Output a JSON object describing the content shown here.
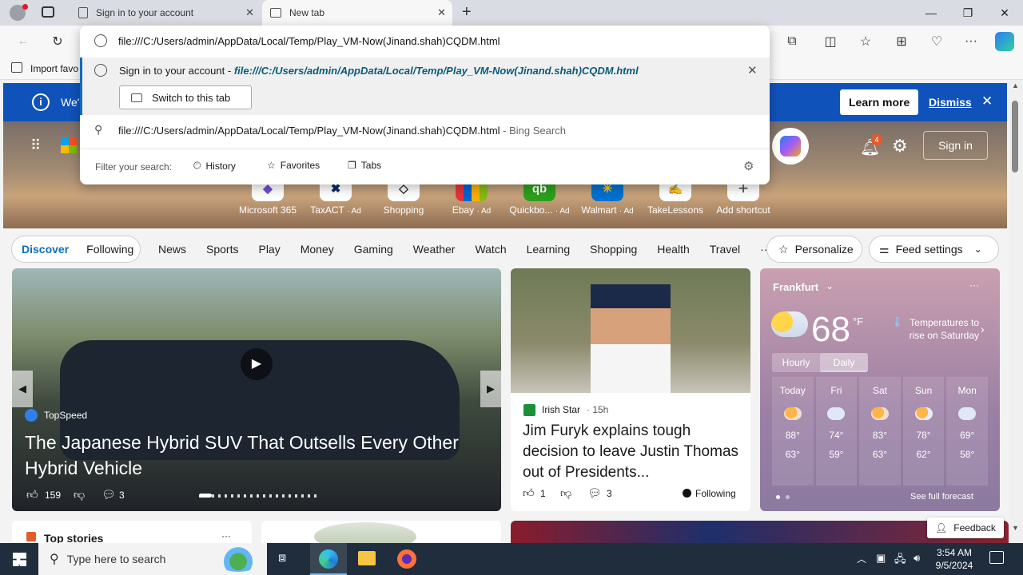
{
  "tabs": [
    {
      "title": "Sign in to your account"
    },
    {
      "title": "New tab"
    }
  ],
  "address": {
    "value": "file:///C:/Users/admin/AppData/Local/Temp/Play_VM-Now(Jinand.shah)CQDM.html"
  },
  "favorites_bar": {
    "import_label": "Import favo"
  },
  "dropdown": {
    "suggestion1_prefix": "Sign in to your account - ",
    "suggestion1_url": "file:///C:/Users/admin/AppData/Local/Temp/Play_VM-Now(Jinand.shah)CQDM.html",
    "switch_tab_label": "Switch to this tab",
    "suggestion2_text": "file:///C:/Users/admin/AppData/Local/Temp/Play_VM-Now(Jinand.shah)CQDM.html",
    "suggestion2_suffix": " - Bing Search",
    "filter_label": "Filter your search:",
    "filters": [
      "History",
      "Favorites",
      "Tabs"
    ]
  },
  "banner": {
    "text": "We'",
    "learn_more": "Learn more",
    "dismiss": "Dismiss"
  },
  "header": {
    "notification_count": "4",
    "sign_in": "Sign in"
  },
  "shortcuts": [
    {
      "label": "Microsoft 365",
      "ad": ""
    },
    {
      "label": "TaxACT",
      "ad": "· Ad"
    },
    {
      "label": "Shopping",
      "ad": ""
    },
    {
      "label": "Ebay",
      "ad": "· Ad"
    },
    {
      "label": "Quickbo...",
      "ad": "· Ad"
    },
    {
      "label": "Walmart",
      "ad": "· Ad"
    },
    {
      "label": "TakeLessons",
      "ad": ""
    },
    {
      "label": "Add shortcut",
      "ad": ""
    }
  ],
  "feed_nav": {
    "discover": "Discover",
    "following": "Following",
    "items": [
      "News",
      "Sports",
      "Play",
      "Money",
      "Gaming",
      "Weather",
      "Watch",
      "Learning",
      "Shopping",
      "Health",
      "Travel"
    ],
    "more": "···",
    "personalize": "Personalize",
    "feed_settings": "Feed settings"
  },
  "hero_card": {
    "source": "TopSpeed",
    "title": "The Japanese Hybrid SUV That Outsells Every Other Hybrid Vehicle",
    "likes": "159",
    "comments": "3"
  },
  "news_card": {
    "source": "Irish Star",
    "age": "· 15h",
    "title": "Jim Furyk explains tough decision to leave Justin Thomas out of Presidents...",
    "likes": "1",
    "comments": "3",
    "following": "Following"
  },
  "weather": {
    "city": "Frankfurt",
    "temp": "68",
    "unit": "°F",
    "note": "Temperatures to rise on Saturday",
    "tab_hourly": "Hourly",
    "tab_daily": "Daily",
    "days": [
      {
        "day": "Today",
        "hi": "88°",
        "lo": "63°"
      },
      {
        "day": "Fri",
        "hi": "74°",
        "lo": "59°"
      },
      {
        "day": "Sat",
        "hi": "83°",
        "lo": "63°"
      },
      {
        "day": "Sun",
        "hi": "78°",
        "lo": "62°"
      },
      {
        "day": "Mon",
        "hi": "69°",
        "lo": "58°"
      }
    ],
    "see_full": "See full forecast"
  },
  "bottom": {
    "top_stories": "Top stories",
    "feedback": "Feedback"
  },
  "taskbar": {
    "search_placeholder": "Type here to search",
    "time": "3:54 AM",
    "date": "9/5/2024"
  }
}
